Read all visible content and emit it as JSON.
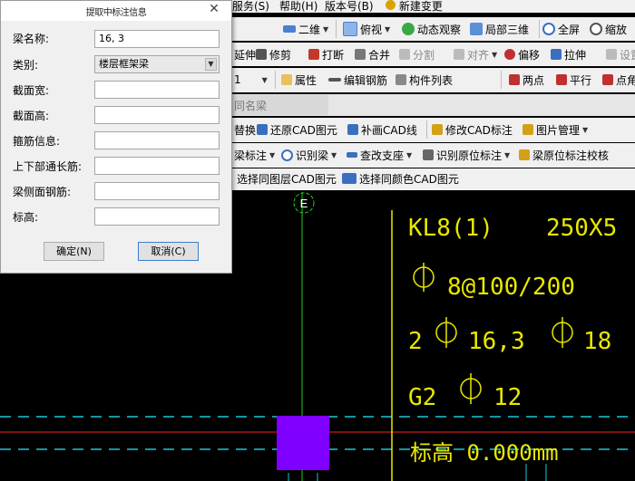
{
  "menubar": {
    "items": [
      "服务(S)",
      "帮助(H)",
      "版本号(B)",
      "新建变更"
    ]
  },
  "toolbar1": {
    "view_mode": "二维",
    "items": [
      "俯视",
      "动态观察",
      "局部三维",
      "全屏",
      "缩放"
    ]
  },
  "toolbar2": {
    "items": [
      "延伸",
      "修剪",
      "打断",
      "合并",
      "分割",
      "对齐",
      "偏移",
      "拉伸",
      "设置"
    ]
  },
  "toolbar3": {
    "floor_value": "1",
    "items": [
      "属性",
      "编辑钢筋",
      "构件列表",
      "两点",
      "平行",
      "点角"
    ]
  },
  "toolbar4": {
    "tab_label": "同名梁"
  },
  "toolbar5": {
    "items": [
      "替换",
      "还原CAD图元",
      "补画CAD线",
      "修改CAD标注",
      "图片管理"
    ]
  },
  "toolbar6": {
    "items": [
      "梁标注",
      "识别梁",
      "查改支座",
      "识别原位标注",
      "梁原位标注校核"
    ]
  },
  "toolbar7": {
    "items": [
      "选择同图层CAD图元",
      "选择同颜色CAD图元"
    ]
  },
  "canvas": {
    "axis_label": "E",
    "annotations": [
      "KL8(1)",
      "250X5",
      "8@100/200",
      "2",
      "16,3",
      "18",
      "G2",
      "12",
      "标高 0.000mm"
    ]
  },
  "dialog": {
    "title": "提取中标注信息",
    "close_glyph": "✕",
    "rows": [
      {
        "label": "梁名称:",
        "value": "16, 3",
        "type": "input"
      },
      {
        "label": "类别:",
        "value": "楼层框架梁",
        "type": "select"
      },
      {
        "label": "截面宽:",
        "value": "",
        "type": "input"
      },
      {
        "label": "截面高:",
        "value": "",
        "type": "input"
      },
      {
        "label": "箍筋信息:",
        "value": "",
        "type": "input"
      },
      {
        "label": "上下部通长筋:",
        "value": "",
        "type": "input"
      },
      {
        "label": "梁侧面钢筋:",
        "value": "",
        "type": "input"
      },
      {
        "label": "标高:",
        "value": "",
        "type": "input"
      }
    ],
    "ok_label": "确定(N)",
    "cancel_label": "取消(C)"
  },
  "colors": {
    "canvas_bg": "#000000",
    "annotation": "#e8e800",
    "axis_line": "#22cc22",
    "dim_line": "#18c8d8",
    "red_line": "#ff2020",
    "column_fill": "#8000ff"
  }
}
